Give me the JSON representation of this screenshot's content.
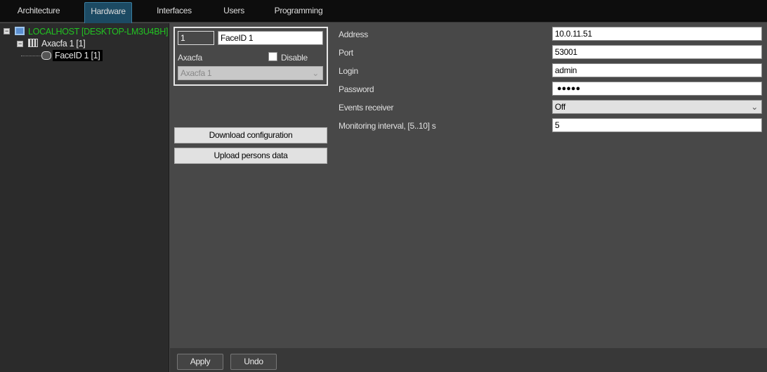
{
  "tabs": [
    {
      "label": "Architecture"
    },
    {
      "label": "Hardware"
    },
    {
      "label": "Interfaces"
    },
    {
      "label": "Users"
    },
    {
      "label": "Programming"
    }
  ],
  "tree": {
    "host": "LOCALHOST [DESKTOP-LM3U4BH]",
    "controller": "Axacfa 1 [1]",
    "device": "FaceID 1 [1]",
    "host_color": "#22c322"
  },
  "device": {
    "number": "1",
    "name": "FaceID 1",
    "parent_label": "Axacfa",
    "disable_label": "Disable",
    "disable_checked": false,
    "parent_value": "Axacfa 1"
  },
  "actions": {
    "download": "Download configuration",
    "upload": "Upload persons data"
  },
  "settings": [
    {
      "label": "Address",
      "value": "10.0.11.51"
    },
    {
      "label": "Port",
      "value": "53001"
    },
    {
      "label": "Login",
      "value": "admin"
    },
    {
      "label": "Password",
      "value": "●●●●●"
    },
    {
      "label": "Events receiver",
      "value": "Off"
    },
    {
      "label": "Monitoring interval, [5..10] s",
      "value": "5"
    }
  ],
  "footer": {
    "apply": "Apply",
    "undo": "Undo"
  }
}
